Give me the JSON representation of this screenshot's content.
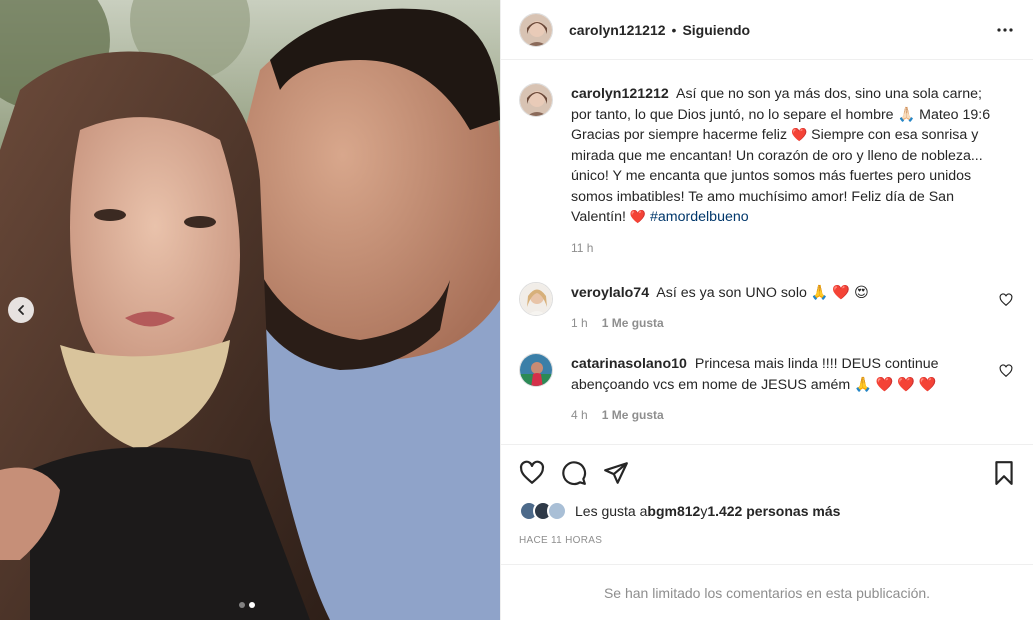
{
  "post": {
    "username": "carolyn121212",
    "separator": "•",
    "following_label": "Siguiendo",
    "more_label": "Más opciones"
  },
  "caption": {
    "username": "carolyn121212",
    "text_part1": "Así que no son ya más dos, sino una sola carne; por tanto, lo que Dios juntó, no lo separe el hombre 🙏🏻 Mateo 19:6 Gracias por siempre hacerme feliz",
    "heart1": "❤️",
    "text_part2": " Siempre con esa sonrisa y mirada que me encantan! Un corazón de oro y lleno de nobleza... único! Y me encanta que juntos somos más fuertes pero unidos somos imbatibles! Te amo muchísimo amor! Feliz día de San Valentín! ",
    "heart2": "❤️",
    "hashtag": "#amordelbueno",
    "time": "11 h"
  },
  "comments": [
    {
      "username": "veroylalo74",
      "text": "Así es ya son UNO solo 🙏 ❤️ 😍",
      "time": "1 h",
      "likes": "1 Me gusta"
    },
    {
      "username": "catarinasolano10",
      "text": "Princesa mais linda !!!! DEUS continue abençoando vcs em nome de JESUS amém 🙏 ❤️ ❤️ ❤️",
      "time": "4 h",
      "likes": "1 Me gusta"
    }
  ],
  "liked": {
    "prefix": "Les gusta a ",
    "user": "bgm812",
    "middle": " y ",
    "others": "1.422 personas más"
  },
  "timestamp": "HACE 11 HORAS",
  "comments_limited": "Se han limitado los comentarios en esta publicación.",
  "carousel": {
    "current": 2,
    "total": 2
  },
  "colors": {
    "heart": "#e0142a",
    "hashtag": "#00376b",
    "muted": "#8e8e8e"
  }
}
